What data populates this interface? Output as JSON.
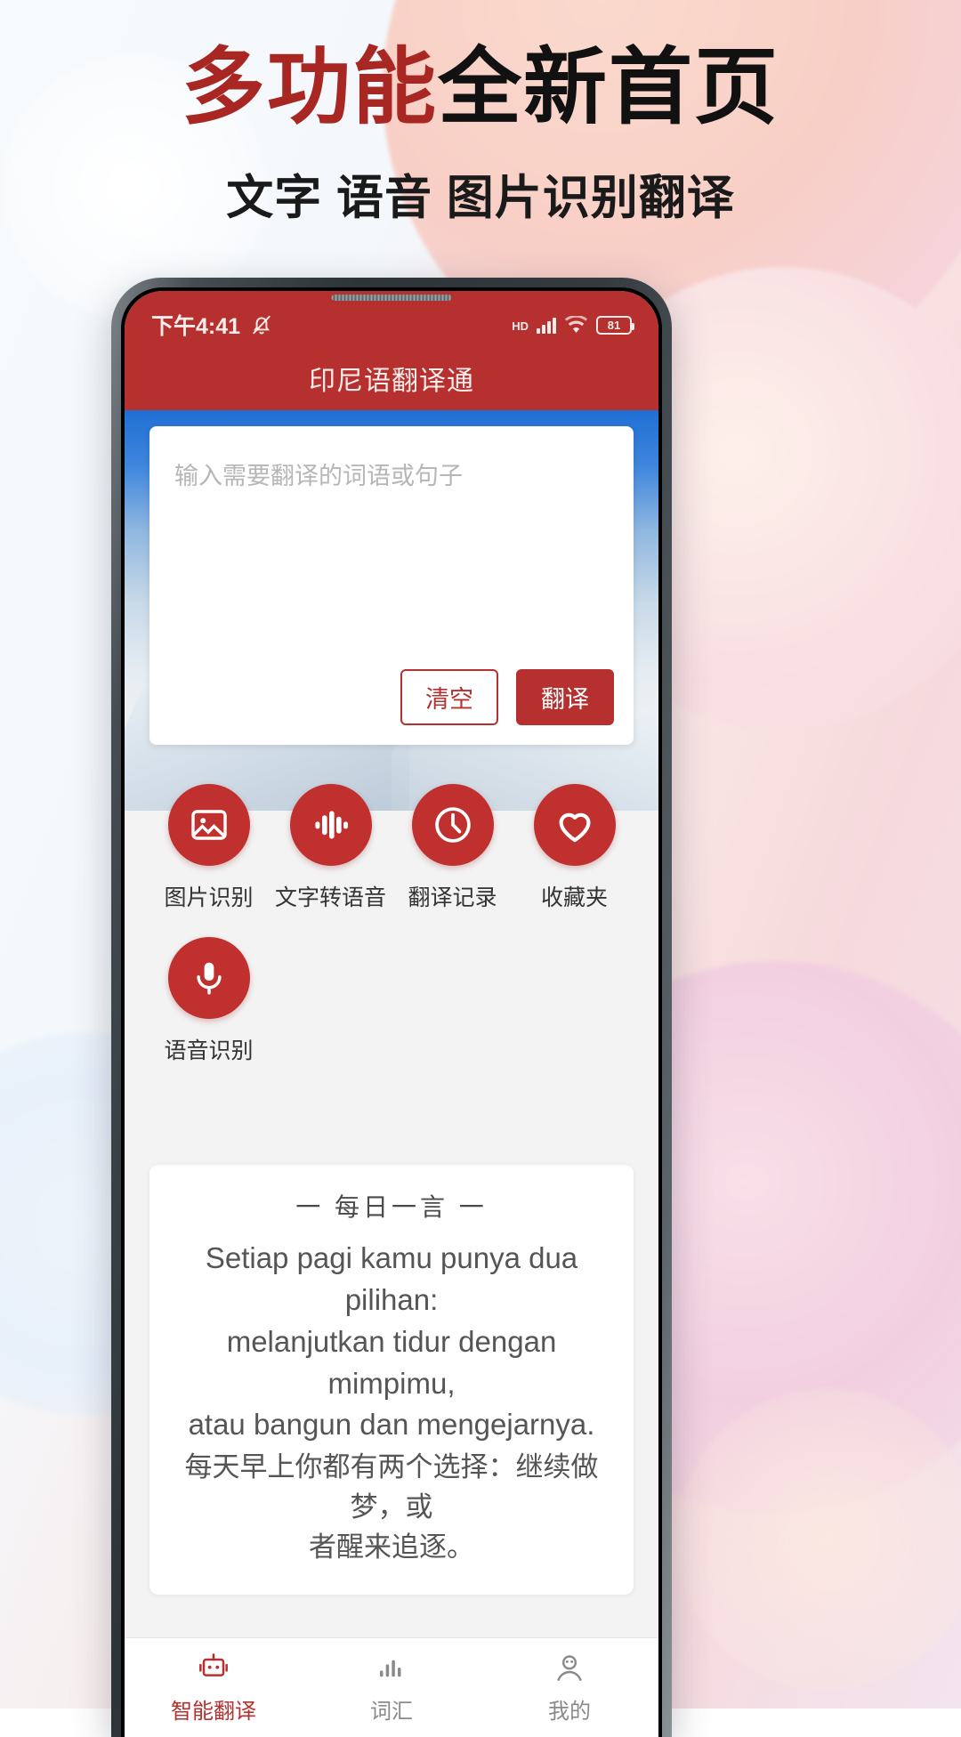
{
  "promo": {
    "title_red": "多功能",
    "title_dark": "全新首页",
    "subtitle": "文字 语音 图片识别翻译"
  },
  "colors": {
    "brand_red": "#b5302f",
    "icon_red": "#c0302e",
    "title_red": "#a92722",
    "hero_blue": "#1f6fd4"
  },
  "phone": {
    "status_bar": {
      "time": "下午4:41",
      "mute_icon": "bell-muted-icon",
      "hd_label": "HD",
      "signal_icon": "signal-bars-icon",
      "wifi_icon": "wifi-icon",
      "battery_level": "81"
    },
    "app_bar": {
      "title": "印尼语翻译通"
    },
    "translate_input": {
      "placeholder": "输入需要翻译的词语或句子",
      "value": "",
      "clear_label": "清空",
      "translate_label": "翻译"
    },
    "features": [
      {
        "label": "图片识别",
        "icon": "image-icon"
      },
      {
        "label": "文字转语音",
        "icon": "waveform-icon"
      },
      {
        "label": "翻译记录",
        "icon": "clock-icon"
      },
      {
        "label": "收藏夹",
        "icon": "heart-icon"
      },
      {
        "label": "语音识别",
        "icon": "microphone-icon"
      }
    ],
    "daily_quote": {
      "title": "一 每日一言 一",
      "text_id_line1": "Setiap pagi kamu punya dua pilihan:",
      "text_id_line2": "melanjutkan tidur dengan mimpimu,",
      "text_id_line3": "atau bangun dan mengejarnya.",
      "text_zh_line1": "每天早上你都有两个选择：继续做梦，或",
      "text_zh_line2": "者醒来追逐。"
    },
    "bottom_nav": [
      {
        "label": "智能翻译",
        "icon": "robot-icon",
        "active": true
      },
      {
        "label": "词汇",
        "icon": "bars-icon",
        "active": false
      },
      {
        "label": "我的",
        "icon": "person-icon",
        "active": false
      }
    ]
  }
}
